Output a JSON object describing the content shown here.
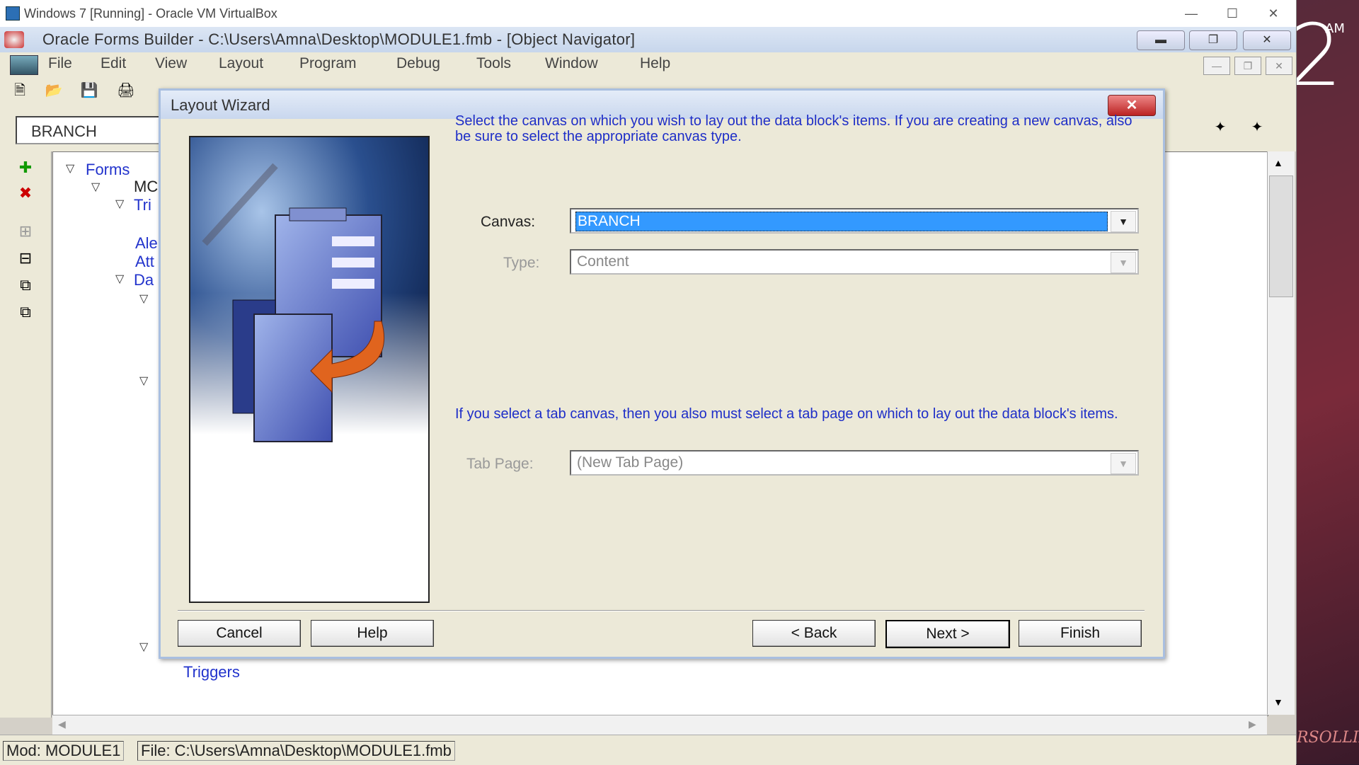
{
  "host": {
    "window_title": "Windows 7 [Running] - Oracle VM VirtualBox",
    "clock_fragment": "AM",
    "big_digit": "2",
    "signature": "VERSOLLIER"
  },
  "app": {
    "title": "Oracle Forms Builder - C:\\Users\\Amna\\Desktop\\MODULE1.fmb - [Object Navigator]",
    "menu": [
      "File",
      "Edit",
      "View",
      "Layout",
      "Program",
      "Debug",
      "Tools",
      "Window",
      "Help"
    ],
    "navigator_field": "BRANCH"
  },
  "tree": {
    "forms": "Forms",
    "module_fragment": "MC",
    "triggers_fragment": "Tri",
    "alerts_fragment": "Ale",
    "attached_fragment": "Att",
    "data_fragment": "Da",
    "triggers": "Triggers"
  },
  "statusbar": {
    "mod": "Mod: MODULE1",
    "file": "File: C:\\Users\\Amna\\Desktop\\MODULE1.fmb"
  },
  "wizard": {
    "title": "Layout Wizard",
    "intro": "Select the canvas on which you wish to lay out the data block's items. If you are creating a new canvas, also be sure to select the appropriate canvas type.",
    "canvas_label": "Canvas:",
    "canvas_value": "BRANCH",
    "type_label": "Type:",
    "type_value": "Content",
    "tab_note": "If you select a tab canvas, then you also must select a tab page on which to lay out the data block's items.",
    "tab_page_label": "Tab Page:",
    "tab_page_value": "(New Tab Page)",
    "buttons": {
      "cancel": "Cancel",
      "help": "Help",
      "back": "< Back",
      "next": "Next >",
      "finish": "Finish"
    }
  }
}
